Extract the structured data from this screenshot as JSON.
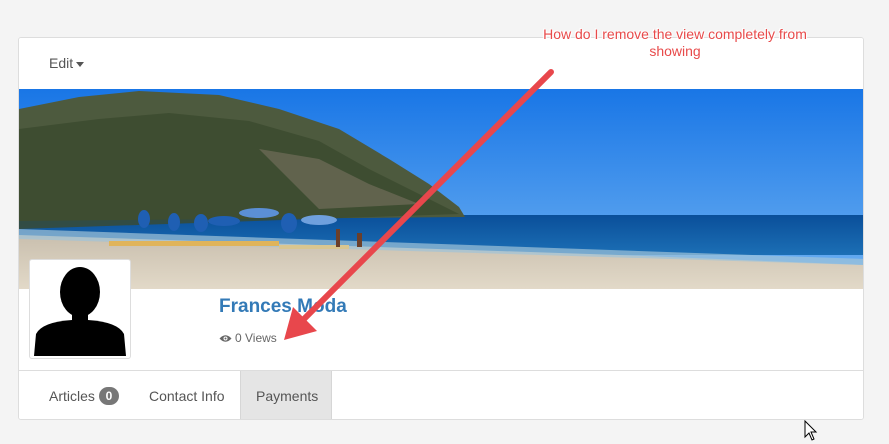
{
  "toolbar": {
    "edit_label": "Edit"
  },
  "profile": {
    "name": "Frances Moda",
    "views_text": "0 Views"
  },
  "tabs": [
    {
      "label": "Articles",
      "badge": "0"
    },
    {
      "label": "Contact Info"
    },
    {
      "label": "Payments",
      "active": true
    }
  ],
  "annotation": {
    "text": "How do I remove the view completely from showing",
    "color": "#e84a4a"
  },
  "colors": {
    "link": "#337ab7",
    "badge": "#777777",
    "active_tab": "#e5e5e5"
  },
  "icons": [
    "caret-down-icon",
    "eye-icon",
    "arrow-annotation-icon",
    "mouse-cursor-icon"
  ]
}
